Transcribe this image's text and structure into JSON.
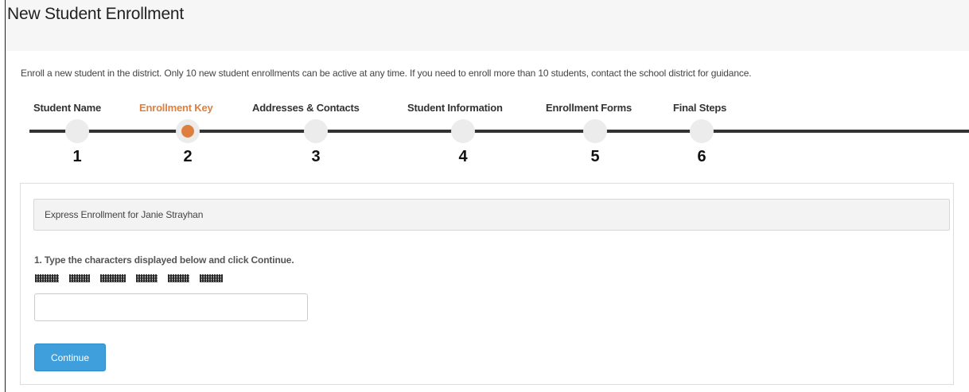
{
  "page": {
    "title": "New Student Enrollment",
    "intro": "Enroll a new student in the district. Only 10 new student enrollments can be active at any time. If you need to enroll more than 10 students, contact the school district for guidance."
  },
  "stepper": {
    "steps": [
      {
        "label": "Student Name",
        "number": "1",
        "active": false
      },
      {
        "label": "Enrollment Key",
        "number": "2",
        "active": true
      },
      {
        "label": "Addresses & Contacts",
        "number": "3",
        "active": false
      },
      {
        "label": "Student Information",
        "number": "4",
        "active": false
      },
      {
        "label": "Enrollment Forms",
        "number": "5",
        "active": false
      },
      {
        "label": "Final Steps",
        "number": "6",
        "active": false
      }
    ],
    "accent_color": "#dd7f3e"
  },
  "panel": {
    "header": "Express Enrollment for Janie Strayhan",
    "instruction": "1. Type the characters displayed below and click Continue.",
    "captcha_input": {
      "value": "",
      "placeholder": ""
    },
    "continue_label": "Continue",
    "button_color": "#3f9fdc"
  }
}
